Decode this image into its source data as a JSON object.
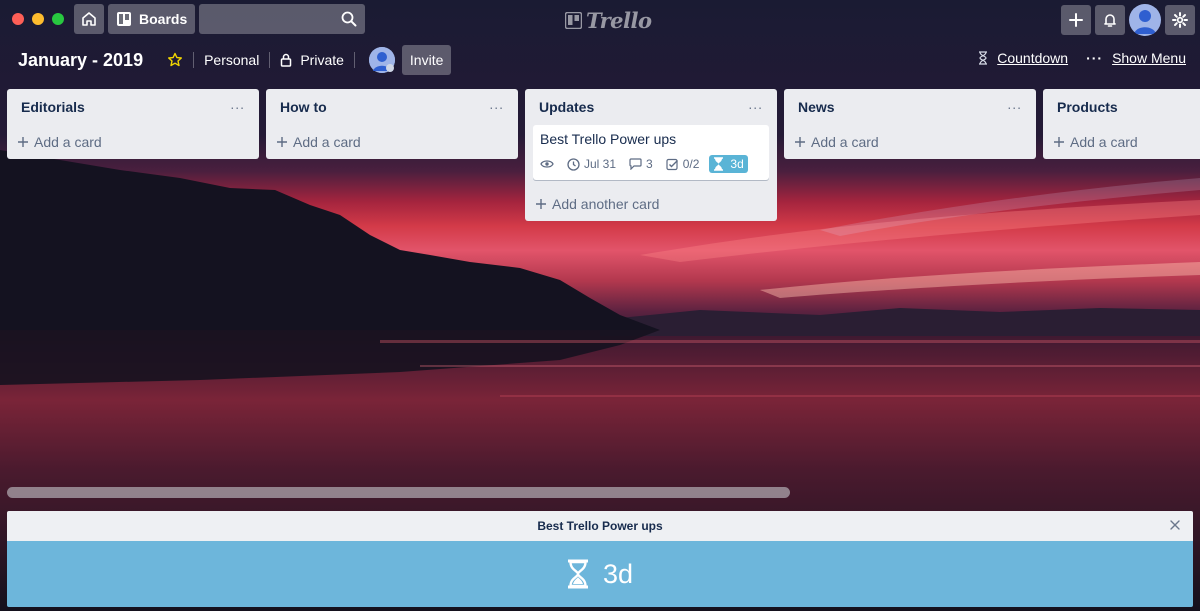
{
  "window": {
    "controls": [
      "close",
      "minimize",
      "maximize"
    ]
  },
  "header": {
    "boards_label": "Boards",
    "search_placeholder": "",
    "logo_text": "Trello",
    "icons": {
      "home": "home-icon",
      "boards": "boards-icon",
      "search": "search-icon",
      "create": "plus-icon",
      "notifications": "bell-icon",
      "settings": "gear-icon"
    }
  },
  "board": {
    "title": "January - 2019",
    "team": "Personal",
    "visibility": "Private",
    "invite_label": "Invite",
    "countdown_label": "Countdown",
    "show_menu_label": "Show Menu"
  },
  "lists": [
    {
      "title": "Editorials",
      "add_label": "Add a card"
    },
    {
      "title": "How to",
      "add_label": "Add a card"
    },
    {
      "title": "Updates",
      "add_label": "Add another card",
      "cards": [
        {
          "title": "Best Trello Power ups",
          "due": "Jul 31",
          "comments": "3",
          "checklist": "0/2",
          "countdown": "3d"
        }
      ]
    },
    {
      "title": "News",
      "add_label": "Add a card"
    },
    {
      "title": "Products",
      "add_label": "Add a card"
    }
  ],
  "countdown_panel": {
    "title": "Best Trello Power ups",
    "value": "3d"
  },
  "colors": {
    "list_bg": "#ebecf0",
    "badge_countdown": "#5ab4d6",
    "panel_body": "#6db6db",
    "panel_head": "#eef0f3"
  }
}
